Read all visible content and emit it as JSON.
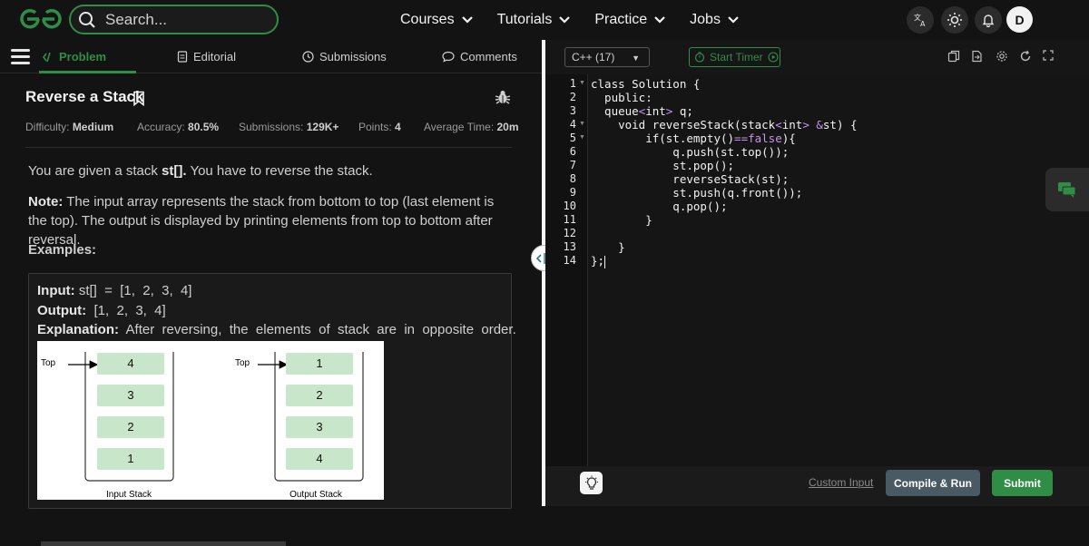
{
  "header": {
    "search_placeholder": "Search...",
    "nav": [
      "Courses",
      "Tutorials",
      "Practice",
      "Jobs"
    ],
    "avatar_initial": "D",
    "brand_color": "#2f8d46"
  },
  "tabs": {
    "problem": "Problem",
    "editorial": "Editorial",
    "submissions": "Submissions",
    "comments": "Comments"
  },
  "problem": {
    "title": "Reverse a Stack",
    "difficulty_label": "Difficulty:",
    "difficulty": "Medium",
    "accuracy_label": "Accuracy:",
    "accuracy": "80.5%",
    "submissions_label": "Submissions:",
    "submissions": "129K+",
    "points_label": "Points:",
    "points": "4",
    "avg_time_label": "Average Time:",
    "avg_time": "20m",
    "statement_pre": "You are given a stack ",
    "statement_bold": "st[].",
    "statement_post": " You have to reverse the stack.",
    "note_label": "Note:",
    "note_text": " The input array represents the stack from bottom to top (last element is the top). The output is displayed by printing elements from top to bottom after reversal.",
    "examples_label": "Examples:",
    "example": {
      "input_label": "Input:",
      "input_value": " st[]  =  [1,  2,  3,  4]",
      "output_label": "Output:",
      "output_value": "  [1,  2,  3,  4]",
      "explanation_label": "Explanation:",
      "explanation_value": "  After  reversing,  the  elements  of  stack  are  in  opposite  order."
    },
    "diagram": {
      "top_label": "Top",
      "input_stack": [
        "4",
        "3",
        "2",
        "1"
      ],
      "output_stack": [
        "1",
        "2",
        "3",
        "4"
      ],
      "input_caption": "Input Stack",
      "output_caption": "Output Stack"
    }
  },
  "editor": {
    "language": "C++ (17)",
    "timer_label": "Start Timer",
    "line_numbers": [
      "1",
      "2",
      "3",
      "4",
      "5",
      "6",
      "7",
      "8",
      "9",
      "10",
      "11",
      "12",
      "13",
      "14"
    ],
    "code": [
      "class Solution {",
      "  public:",
      "  queue<int> q;",
      "    void reverseStack(stack<int> &st) {",
      "        if(st.empty()==false){",
      "            q.push(st.top());",
      "            st.pop();",
      "            reverseStack(st);",
      "            st.push(q.front());",
      "            q.pop();",
      "        }",
      "",
      "    }",
      "};"
    ],
    "custom_input": "Custom Input",
    "compile_run": "Compile & Run",
    "submit": "Submit"
  }
}
